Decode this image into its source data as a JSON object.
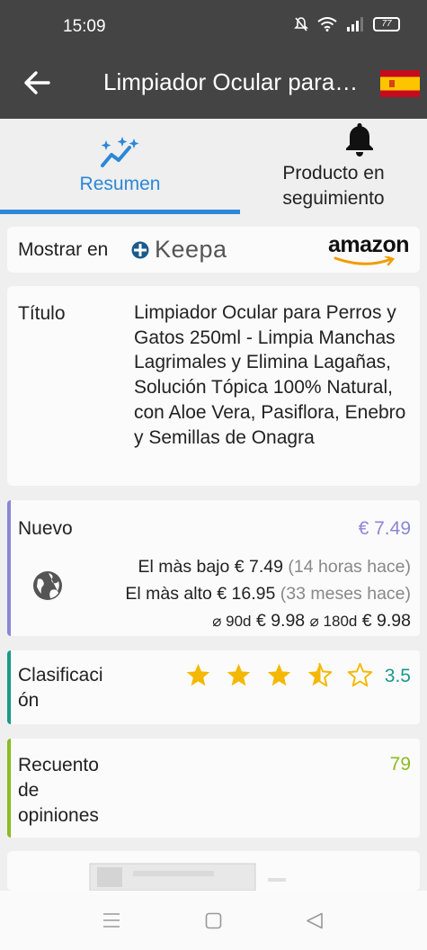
{
  "status": {
    "time": "15:09",
    "battery": "77"
  },
  "appbar": {
    "title": "Limpiador Ocular para Perros y Gatos 250ml - Limpia Manchas Lagrimales y Elimina Lagañas, Solución Tópica 100% Natural, con Aloe Vera, Pasiflora, Enebro y Semillas de Onagra",
    "flag": "spain-flag"
  },
  "tabs": [
    {
      "label": "Resumen",
      "active": true,
      "icon": "sparkle-chart-icon"
    },
    {
      "label_line1": "Producto en",
      "label_line2": "seguimiento",
      "active": false,
      "icon": "bell-icon"
    }
  ],
  "show_in": {
    "label": "Mostrar en",
    "keepa": "Keepa",
    "amazon": "amazon"
  },
  "title_card": {
    "label": "Título",
    "value": "Limpiador Ocular para Perros y Gatos 250ml - Limpia Manchas Lagrimales y Elimina Lagañas, Solución Tópica 100% Natural, con Aloe Vera, Pasiflora, Enebro y Semillas de Onagra"
  },
  "new_card": {
    "label": "Nuevo",
    "price": "€ 7.49",
    "lowest_label": "El màs bajo",
    "lowest_price": "€ 7.49",
    "lowest_when": "(14 horas hace)",
    "highest_label": "El màs alto",
    "highest_price": "€ 16.95",
    "highest_when": "(33 meses hace)",
    "avg90_label": "⌀ 90d",
    "avg90_price": "€ 9.98",
    "avg180_label": "⌀ 180d",
    "avg180_price": "€ 9.98",
    "accent": "#8c86d6"
  },
  "rating_card": {
    "label_line1": "Clasificaci",
    "label_line2": "ón",
    "stars": 3.5,
    "value": "3.5",
    "accent": "#1a9a8a",
    "star_color": "#f5b800"
  },
  "reviews_card": {
    "label_line1": "Recuento",
    "label_line2": "de",
    "label_line3": "opiniones",
    "value": "79",
    "accent": "#8bbb22"
  }
}
